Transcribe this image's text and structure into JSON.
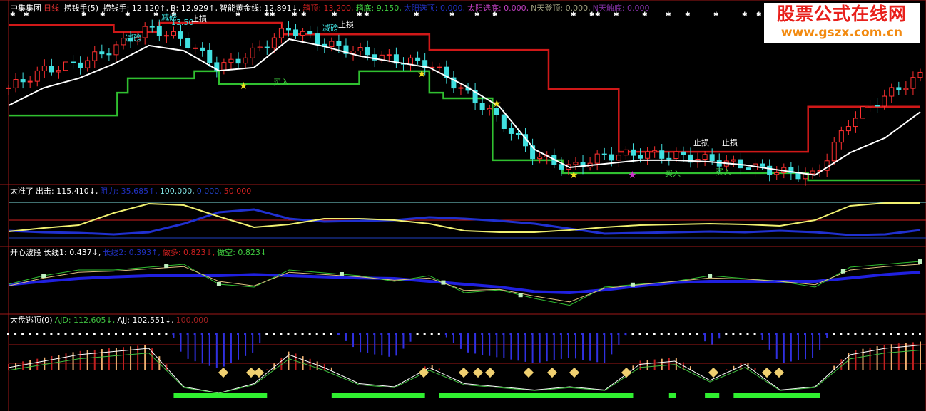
{
  "main_header": {
    "stock": "中集集团",
    "period": "日线",
    "indicator": "捞钱手(5)",
    "items": [
      {
        "label": "捞钱手: 12.120↑,",
        "color": "#ffffff"
      },
      {
        "label": "B: 12.929↑,",
        "color": "#ffffff"
      },
      {
        "label": "智能黄金线: 12.891↓,",
        "color": "#ffffff"
      },
      {
        "label": "箱顶: 13.200,",
        "color": "#d02020"
      },
      {
        "label": "箱底: 9.150,",
        "color": "#40d040"
      },
      {
        "label": "太阳选顶: 0.000,",
        "color": "#2030c0"
      },
      {
        "label": "太阳选底: 0.000,",
        "color": "#c040c0"
      },
      {
        "label": "N天登顶: 0.000,",
        "color": "#a0a080"
      },
      {
        "label": "N天触底: 0.000",
        "color": "#8030a0"
      }
    ]
  },
  "panel2_header": {
    "name": "太准了",
    "items": [
      {
        "label": "出击: 115.410↓,",
        "color": "#ffffff"
      },
      {
        "label": "阻力: 35.685↑,",
        "color": "#2030c0"
      },
      {
        "label": "100.000,",
        "color": "#80e0e0"
      },
      {
        "label": "0.000,",
        "color": "#2040c0"
      },
      {
        "label": "50.000",
        "color": "#d02020"
      }
    ]
  },
  "panel3_header": {
    "name": "开心波段",
    "items": [
      {
        "label": "长线1: 0.437↓,",
        "color": "#ffffff"
      },
      {
        "label": "长线2: 0.393↑,",
        "color": "#2030c0"
      },
      {
        "label": "做多: 0.823↓,",
        "color": "#d02020"
      },
      {
        "label": "做空: 0.823↓",
        "color": "#40d040"
      }
    ]
  },
  "panel4_header": {
    "name": "大盘逃顶(0)",
    "items": [
      {
        "label": "AJD: 112.605↓,",
        "color": "#40c040"
      },
      {
        "label": "AJJ: 102.551↓,",
        "color": "#ffffff"
      },
      {
        "label": "100.000",
        "color": "#a02020"
      }
    ]
  },
  "annotations": {
    "reduce": "减磅",
    "stop": "止损",
    "buy": "买入",
    "stop_price": "13.50"
  },
  "watermark": {
    "title": "股票公式在线网",
    "url": "www.gszx.com.cn"
  },
  "colors": {
    "box_top": "#d01818",
    "box_bottom": "#30c030",
    "ma": "#ffffff",
    "up": "#ff3030",
    "down": "#40e0e0"
  },
  "chart_data": [
    {
      "type": "line",
      "title": "捞钱手(5) 日线",
      "x_index_range": [
        0,
        26
      ],
      "ylim": [
        9.0,
        13.6
      ],
      "series": [
        {
          "name": "箱顶",
          "step": true,
          "points": [
            [
              0,
              12.98
            ],
            [
              3,
              12.8
            ],
            [
              4.3,
              13.03
            ],
            [
              7.8,
              12.74
            ],
            [
              12,
              12.35
            ],
            [
              15.4,
              11.37
            ],
            [
              17.4,
              9.8
            ],
            [
              22.8,
              10.93
            ],
            [
              26,
              10.93
            ]
          ]
        },
        {
          "name": "箱底",
          "step": true,
          "points": [
            [
              0,
              10.71
            ],
            [
              3.1,
              11.28
            ],
            [
              3.4,
              11.64
            ],
            [
              5.3,
              11.82
            ],
            [
              6,
              11.5
            ],
            [
              10,
              11.82
            ],
            [
              12,
              11.28
            ],
            [
              12.4,
              11.14
            ],
            [
              13.8,
              9.59
            ],
            [
              15.8,
              9.27
            ],
            [
              22.8,
              9.09
            ],
            [
              26,
              9.09
            ]
          ]
        },
        {
          "name": "智能黄金线",
          "values": [
            10.96,
            11.4,
            11.64,
            12.0,
            12.46,
            12.33,
            11.83,
            11.91,
            12.62,
            12.44,
            12.2,
            12.05,
            11.91,
            11.46,
            10.93,
            9.86,
            9.41,
            9.5,
            9.59,
            9.59,
            9.55,
            9.47,
            9.34,
            9.22,
            9.78,
            10.15,
            10.8
          ]
        },
        {
          "name": "收盘",
          "values": [
            11.4,
            11.85,
            12.0,
            12.4,
            12.9,
            12.6,
            11.9,
            12.3,
            12.9,
            12.5,
            12.3,
            12.1,
            12.0,
            11.3,
            10.6,
            9.7,
            9.4,
            9.7,
            9.75,
            9.7,
            9.6,
            9.45,
            9.3,
            9.2,
            10.6,
            11.2,
            11.7
          ]
        }
      ]
    },
    {
      "type": "line",
      "title": "太准了",
      "ylim": [
        0,
        100
      ],
      "hlines": [
        100,
        50,
        0
      ],
      "series": [
        {
          "name": "出击",
          "color": "#f0f070",
          "values": [
            18,
            28,
            36,
            70,
            96,
            92,
            60,
            30,
            38,
            54,
            54,
            50,
            40,
            20,
            16,
            16,
            22,
            30,
            36,
            38,
            40,
            38,
            34,
            50,
            90,
            98,
            98
          ]
        },
        {
          "name": "阻力",
          "color": "#2030d0",
          "values": [
            20,
            16,
            14,
            10,
            16,
            40,
            72,
            80,
            54,
            46,
            48,
            50,
            58,
            54,
            48,
            40,
            26,
            12,
            14,
            16,
            18,
            16,
            20,
            16,
            8,
            10,
            22
          ]
        }
      ]
    },
    {
      "type": "line",
      "title": "开心波段",
      "ylim": [
        0,
        1
      ],
      "series": [
        {
          "name": "长线2",
          "color": "#2020e0",
          "values": [
            0.44,
            0.5,
            0.55,
            0.58,
            0.6,
            0.6,
            0.6,
            0.62,
            0.6,
            0.58,
            0.56,
            0.55,
            0.5,
            0.45,
            0.4,
            0.32,
            0.3,
            0.35,
            0.42,
            0.48,
            0.5,
            0.5,
            0.5,
            0.5,
            0.56,
            0.62,
            0.66
          ]
        },
        {
          "name": "做空",
          "color": "#30c030",
          "values": [
            0.45,
            0.6,
            0.7,
            0.7,
            0.75,
            0.8,
            0.45,
            0.4,
            0.7,
            0.65,
            0.6,
            0.5,
            0.6,
            0.3,
            0.35,
            0.2,
            0.08,
            0.4,
            0.45,
            0.5,
            0.6,
            0.55,
            0.5,
            0.4,
            0.75,
            0.8,
            0.85
          ]
        },
        {
          "name": "长线1",
          "color": "#e0c080",
          "values": [
            0.42,
            0.56,
            0.66,
            0.68,
            0.72,
            0.76,
            0.5,
            0.42,
            0.66,
            0.62,
            0.58,
            0.52,
            0.56,
            0.34,
            0.36,
            0.24,
            0.14,
            0.38,
            0.44,
            0.5,
            0.56,
            0.54,
            0.5,
            0.44,
            0.7,
            0.76,
            0.8
          ]
        }
      ]
    },
    {
      "type": "bar",
      "title": "大盘逃顶(0)",
      "ylim": [
        -100,
        100
      ],
      "oscillator": [
        20,
        40,
        60,
        70,
        80,
        -40,
        -60,
        -30,
        60,
        20,
        -30,
        -40,
        20,
        -30,
        -40,
        -50,
        -40,
        -50,
        30,
        40,
        -20,
        30,
        -50,
        -40,
        60,
        80,
        90
      ],
      "signal_segments": [
        [
          23,
          36
        ],
        [
          45,
          58
        ],
        [
          60,
          87
        ],
        [
          92,
          93
        ],
        [
          97,
          99
        ],
        [
          101,
          113
        ]
      ]
    }
  ]
}
